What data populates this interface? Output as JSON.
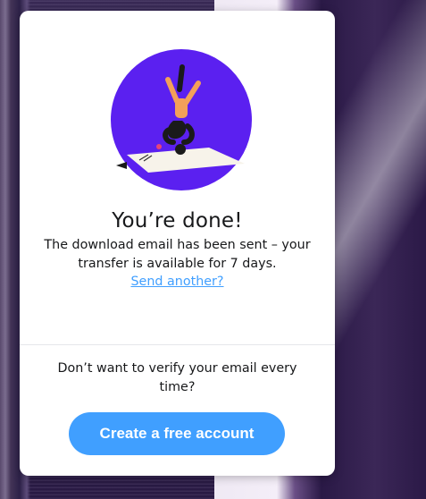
{
  "card": {
    "title": "You’re done!",
    "message": "The download email has been sent – your transfer is available for 7 days.",
    "send_another_link": "Send another?",
    "verify_prompt": "Don’t want to verify your email every time?",
    "create_account_button": "Create a free account"
  },
  "illustration": {
    "icon": "yoga-person-on-mat-illustration",
    "circle_color": "#5b20f0"
  },
  "colors": {
    "accent": "#409fff",
    "text": "#17181a"
  }
}
